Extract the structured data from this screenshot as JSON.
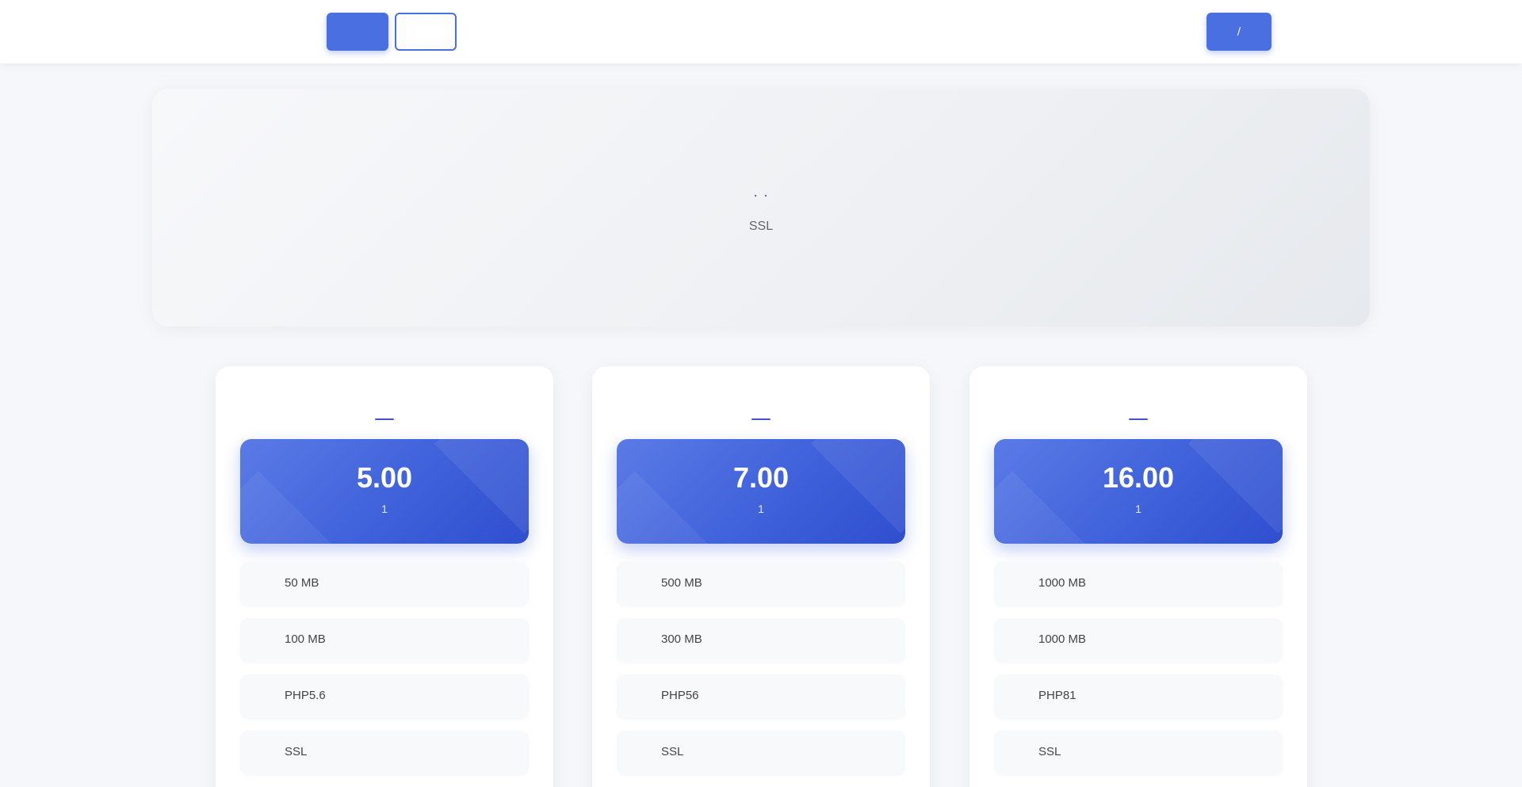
{
  "header": {
    "brand": "",
    "nav_primary": "",
    "nav_outline": "",
    "login": "/"
  },
  "hero": {
    "title": "",
    "subtitle": " ·  · ",
    "desc1": "SSL",
    "desc2": ""
  },
  "plans": [
    {
      "title": "",
      "price": "5.00",
      "period": "1",
      "features": [
        "50 MB",
        "100 MB",
        "PHP5.6",
        "SSL"
      ]
    },
    {
      "title": "",
      "price": "7.00",
      "period": "1",
      "features": [
        "500 MB",
        "300 MB",
        "PHP56",
        "SSL"
      ]
    },
    {
      "title": "",
      "price": "16.00",
      "period": "1",
      "features": [
        "1000 MB",
        "1000 MB",
        "PHP81",
        "SSL"
      ]
    }
  ],
  "colors": {
    "accent": "#4a6fe0",
    "background": "#f5f7fa",
    "title": "#2c3e50"
  }
}
